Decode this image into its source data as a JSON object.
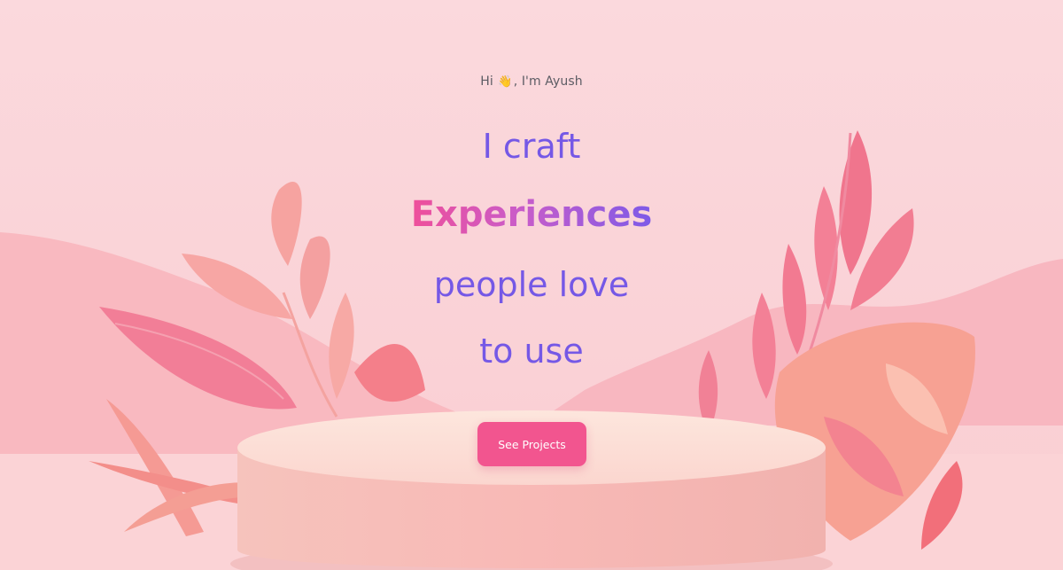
{
  "hero": {
    "greeting_prefix": "Hi",
    "greeting_emoji": "👋",
    "greeting_suffix": ", I'm Ayush",
    "line1": "I craft",
    "line2": "Experiences",
    "line3": "people love",
    "line4": "to use",
    "cta_label": "See Projects"
  },
  "colors": {
    "background": "#fbd8dc",
    "heading_purple": "#7558e6",
    "gradient_start": "#ef4f9a",
    "gradient_end": "#7d5ae8",
    "button": "#f2558f"
  }
}
